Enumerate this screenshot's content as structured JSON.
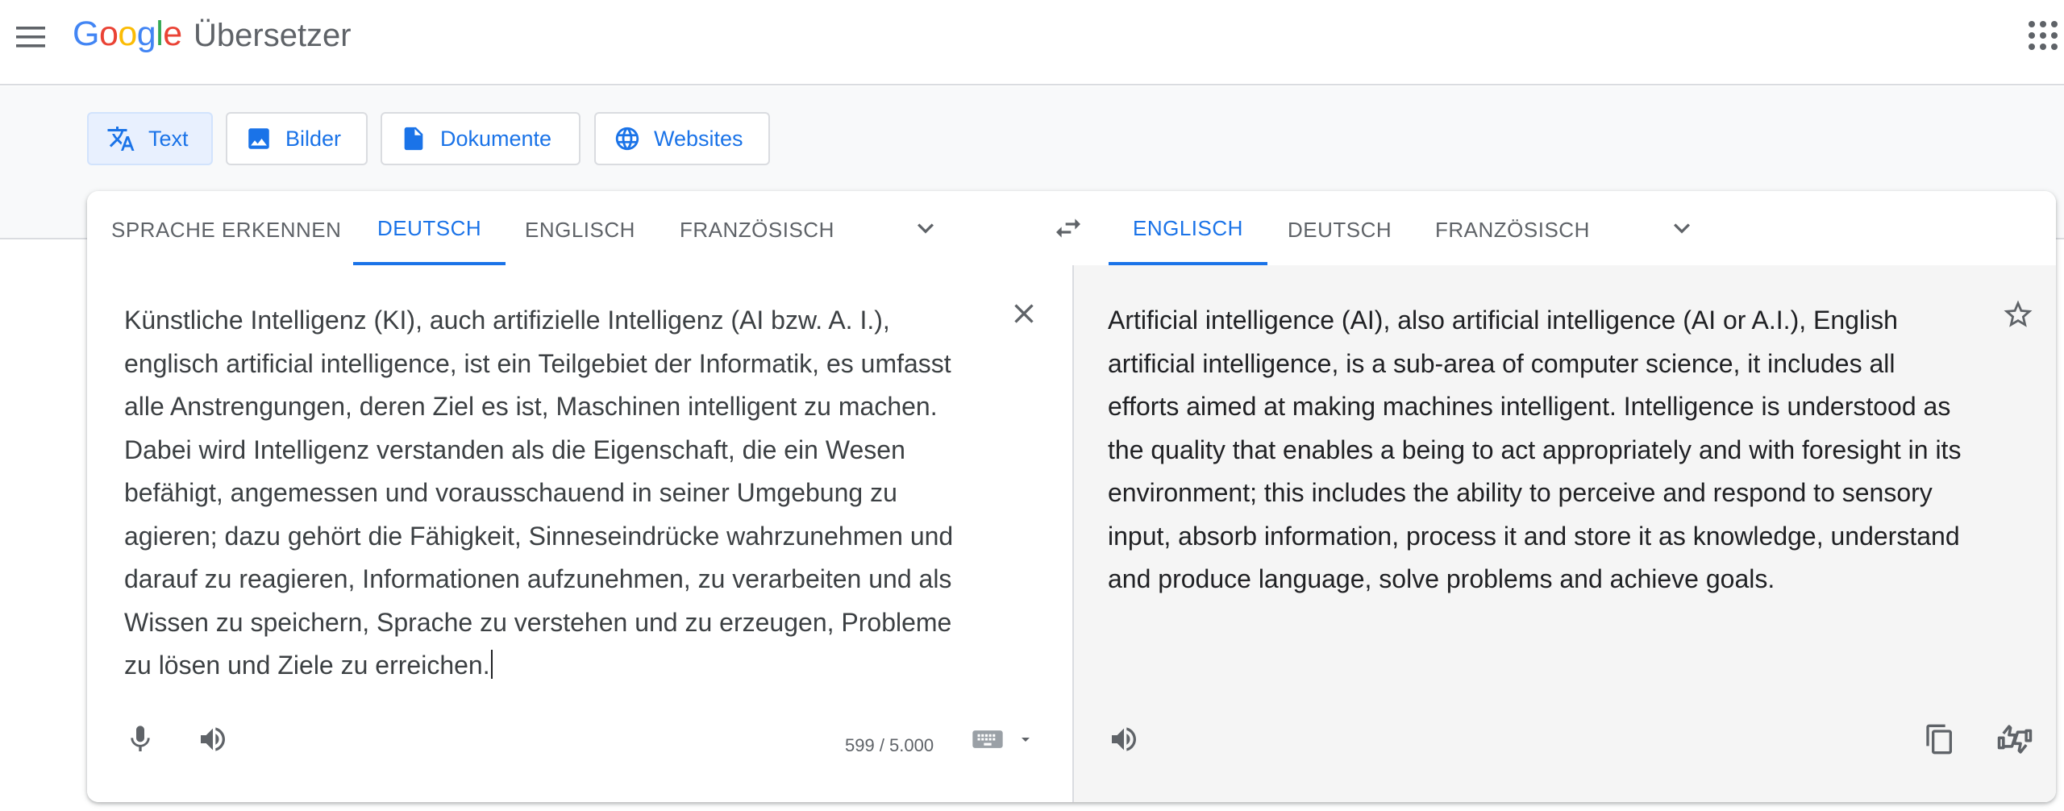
{
  "header": {
    "logo": [
      "G",
      "o",
      "o",
      "g",
      "l",
      "e"
    ],
    "product": "Übersetzer",
    "menu_icon": "menu-icon",
    "apps_icon": "apps-grid-icon"
  },
  "modes": [
    {
      "label": "Text",
      "icon": "translate-icon",
      "active": true
    },
    {
      "label": "Bilder",
      "icon": "image-icon",
      "active": false
    },
    {
      "label": "Dokumente",
      "icon": "document-icon",
      "active": false
    },
    {
      "label": "Websites",
      "icon": "globe-icon",
      "active": false
    }
  ],
  "source_langs": [
    "SPRACHE ERKENNEN",
    "DEUTSCH",
    "ENGLISCH",
    "FRANZÖSISCH"
  ],
  "target_langs": [
    "ENGLISCH",
    "DEUTSCH",
    "FRANZÖSISCH"
  ],
  "source_text": "Künstliche Intelligenz (KI), auch artifizielle Intelligenz (AI bzw. A. I.), englisch artificial intelligence, ist ein Teilgebiet der Informatik, es umfasst alle Anstrengungen, deren Ziel es ist, Maschinen intelligent zu machen. Dabei wird Intelligenz verstanden als die Eigenschaft, die ein Wesen befähigt, angemessen und vorausschauend in seiner Umgebung zu agieren; dazu gehört die Fähigkeit, Sinneseindrücke wahrzunehmen und darauf zu reagieren, Informationen aufzunehmen, zu verarbeiten und als Wissen zu speichern, Sprache zu verstehen und zu erzeugen, Probleme zu lösen und Ziele zu erreichen.",
  "target_text": "Artificial intelligence (AI), also artificial intelligence (AI or A.I.), English artificial intelligence, is a sub-area of computer science, it includes all efforts aimed at making machines intelligent. Intelligence is understood as the quality that enables a being to act appropriately and with foresight in its environment; this includes the ability to perceive and respond to sensory input, absorb information, process it and store it as knowledge, understand and produce language, solve problems and achieve goals.",
  "char_count": "599 / 5.000",
  "colors": {
    "accent": "#1a73e8",
    "active_bg": "#e8f0fe",
    "target_bg": "#f5f5f5"
  }
}
